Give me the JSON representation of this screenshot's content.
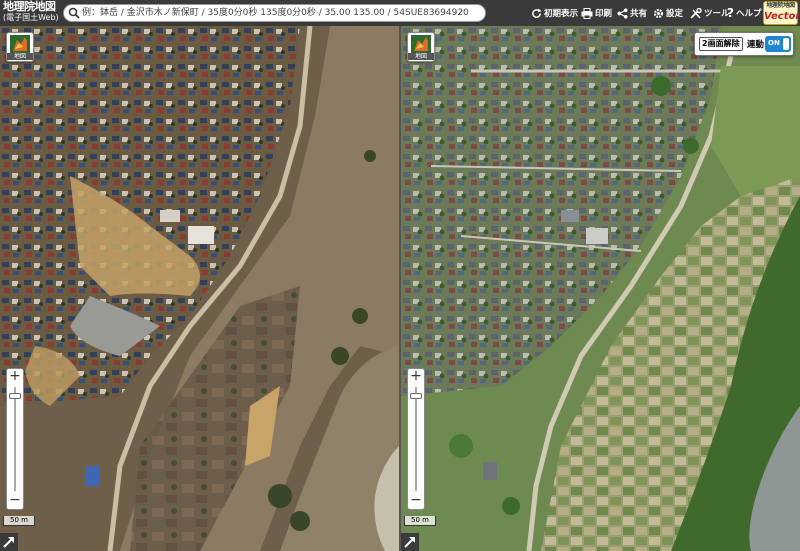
{
  "app": {
    "logo_main": "地理院地図",
    "logo_sub": "(電子国土Web)"
  },
  "search": {
    "placeholder": "例：鉢岳 / 金沢市木ノ新保町 / 35度0分0秒 135度0分0秒 / 35.00 135.00 / 54SUE83694920"
  },
  "toolbar": {
    "home_label": "初期表示",
    "print_label": "印刷",
    "share_label": "共有",
    "settings_label": "設定",
    "tools_label": "ツール",
    "help_label": "ヘルプ"
  },
  "vector_badge": {
    "top": "地理院地図",
    "bottom": "Vector"
  },
  "left_map": {
    "layer_label": "地図",
    "scale_label": "50 m",
    "zoom_in": "+",
    "zoom_out": "−"
  },
  "right_map": {
    "layer_label": "地図",
    "scale_label": "50 m",
    "zoom_in": "+",
    "zoom_out": "−",
    "split_release_label": "2画面解除",
    "sync_label": "連動",
    "sync_state": "ON"
  },
  "icons": {
    "search": "search-icon",
    "home": "refresh-icon",
    "print": "printer-icon",
    "share": "share-icon",
    "settings": "gear-icon",
    "tools": "tools-icon",
    "help": "help-icon",
    "layers": "layer-icon",
    "expand": "expand-arrow-icon"
  },
  "colors": {
    "topbar": "#3a3a3a",
    "sync_on": "#1d87d6",
    "flood_water": "#9c8a6e",
    "vegetation": "#5f7f45"
  }
}
